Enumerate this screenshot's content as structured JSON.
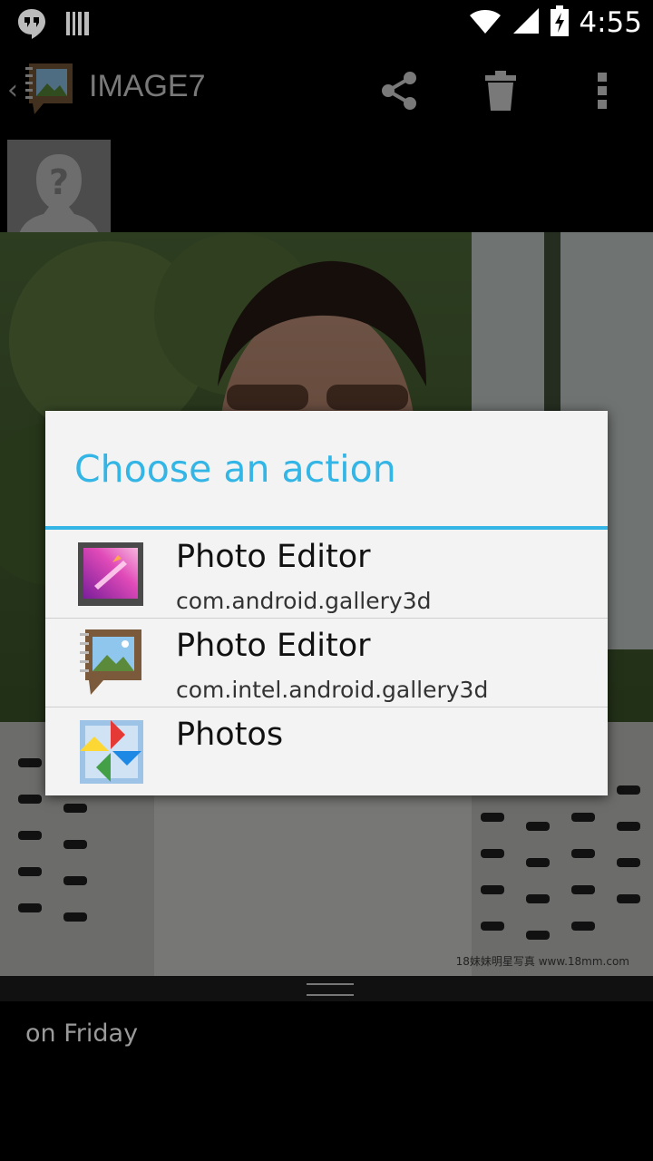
{
  "status_bar": {
    "time": "4:55",
    "icons": [
      "hangouts-icon",
      "barcode-icon",
      "wifi-icon",
      "signal-icon",
      "battery-charging-icon"
    ]
  },
  "action_bar": {
    "title": "IMAGE7",
    "up_glyph": "‹",
    "actions": [
      "share-icon",
      "delete-icon",
      "overflow-menu-icon"
    ]
  },
  "photo": {
    "watermark": "18妹妹明星写真 www.18mm.com"
  },
  "info": {
    "text": "on Friday"
  },
  "dialog": {
    "title": "Choose an action",
    "accent_color": "#33b5e5",
    "items": [
      {
        "label": "Photo Editor",
        "package": "com.android.gallery3d",
        "icon": "gallery-icon"
      },
      {
        "label": "Photo Editor",
        "package": "com.intel.android.gallery3d",
        "icon": "notebook-gallery-icon"
      },
      {
        "label": "Photos",
        "package": "",
        "icon": "google-photos-icon"
      }
    ]
  }
}
